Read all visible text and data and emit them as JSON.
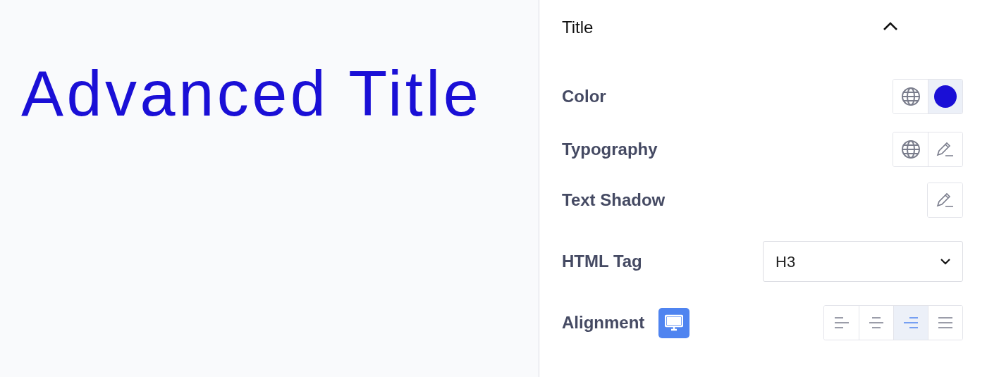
{
  "preview": {
    "title": "Advanced Title",
    "color": "#1a0fd6"
  },
  "panel": {
    "section_title": "Title",
    "expanded": true,
    "rows": [
      {
        "kind": "buttons",
        "label": "Color",
        "buttons": [
          {
            "kind": "globe",
            "selected": false
          },
          {
            "kind": "swatch",
            "selected": true,
            "color": "#1a0fd6"
          }
        ]
      },
      {
        "kind": "buttons",
        "label": "Typography",
        "buttons": [
          {
            "kind": "globe",
            "selected": false
          },
          {
            "kind": "pencil",
            "selected": false
          }
        ]
      },
      {
        "kind": "buttons",
        "label": "Text Shadow",
        "buttons": [
          {
            "kind": "pencil",
            "selected": false
          }
        ]
      },
      {
        "kind": "select",
        "label": "HTML Tag",
        "value": "H3"
      },
      {
        "kind": "align",
        "label": "Alignment",
        "responsive": true,
        "options": [
          {
            "kind": "left",
            "selected": false
          },
          {
            "kind": "center",
            "selected": false
          },
          {
            "kind": "right",
            "selected": true
          },
          {
            "kind": "justify",
            "selected": false
          }
        ]
      }
    ]
  }
}
